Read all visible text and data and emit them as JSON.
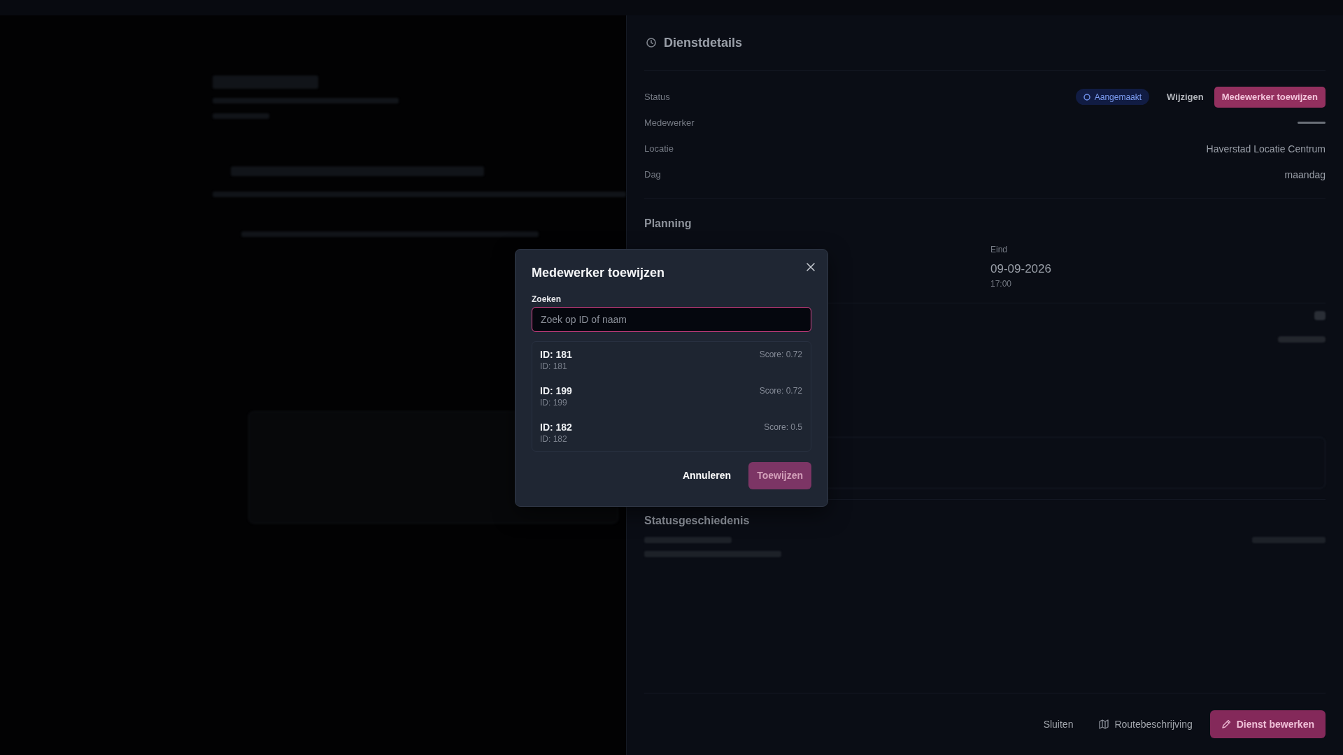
{
  "background_panel": {
    "title": "Dienstdetails",
    "details": [
      {
        "label": "Status",
        "kind": "status",
        "badge": "Aangemaakt",
        "actions": [
          {
            "label": "Wijzigen",
            "kind": "text"
          },
          {
            "label": "Medewerker toewijzen",
            "kind": "primary"
          }
        ]
      },
      {
        "label": "Medewerker",
        "kind": "empty"
      },
      {
        "label": "Locatie",
        "kind": "text",
        "value": "Haverstad Locatie Centrum"
      },
      {
        "label": "Dag",
        "kind": "text",
        "value": "maandag"
      }
    ],
    "planning": {
      "title": "Planning",
      "end_label": "Eind",
      "end_date": "09-09-2026",
      "end_time": "17:00"
    },
    "history": {
      "title": "Statusgeschiedenis"
    },
    "footer_buttons": [
      {
        "label": "Sluiten",
        "kind": "text"
      },
      {
        "label": "Routebeschrijving",
        "kind": "icon"
      },
      {
        "label": "Dienst bewerken",
        "kind": "primary"
      }
    ]
  },
  "dialog": {
    "title": "Medewerker toewijzen",
    "search": {
      "label": "Zoeken",
      "placeholder": "Zoek op ID of naam",
      "focused": true
    },
    "results": [
      {
        "name": "ID: 181",
        "detail": "ID: 181",
        "score": "Score: 0.72",
        "selected": false
      },
      {
        "name": "ID: 199",
        "detail": "ID: 199",
        "score": "Score: 0.72",
        "selected": false
      },
      {
        "name": "ID: 182",
        "detail": "ID: 182",
        "score": "Score: 0.5",
        "selected": false
      }
    ],
    "buttons": [
      {
        "label": "Annuleren",
        "kind": "secondary",
        "disabled": false
      },
      {
        "label": "Toewijzen",
        "kind": "primary",
        "disabled": true
      }
    ]
  }
}
